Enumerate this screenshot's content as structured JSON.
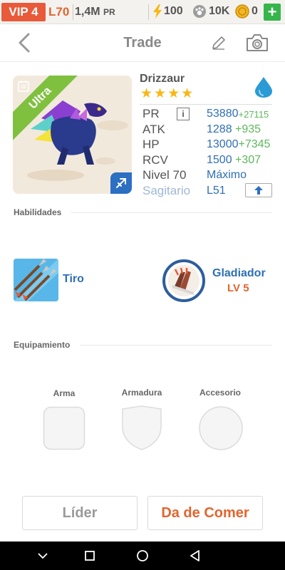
{
  "topbar": {
    "vip": "VIP 4",
    "level": "L70",
    "power": "1,4M",
    "power_unit": "PR",
    "energy": "100",
    "food": "10K",
    "coins": "0",
    "add": "+"
  },
  "header": {
    "title": "Trade"
  },
  "monster": {
    "name": "Drizzaur",
    "rarity": "Ultra",
    "stars": [
      "★",
      "★",
      "★",
      "★"
    ],
    "stats": [
      {
        "label": "PR",
        "value": "53880",
        "bonus": "+27115"
      },
      {
        "label": "ATK",
        "value": "1288",
        "bonus": " +935"
      },
      {
        "label": "HP",
        "value": "13000",
        "bonus": "+7345"
      },
      {
        "label": "RCV",
        "value": "1500",
        "bonus": " +307"
      },
      {
        "label": "Nivel 70",
        "value": "Máximo",
        "bonus": ""
      },
      {
        "label": "Sagitario",
        "value": "L51",
        "bonus": ""
      }
    ],
    "info": "i"
  },
  "abilities": {
    "section_label": "Habilidades",
    "skill_name": "Tiro",
    "trait_name": "Gladiador",
    "trait_level": "LV 5"
  },
  "equipment": {
    "section_label": "Equipamiento",
    "slots": [
      "Arma",
      "Armadura",
      "Accesorio"
    ]
  },
  "buttons": {
    "leader": "Líder",
    "feed": "Da de Comer"
  },
  "colors": {
    "vip": "#e85a3a",
    "accent_orange": "#e2652e",
    "stat_blue": "#2f6fb3",
    "bonus_green": "#5cb85c",
    "ultra_green": "#7fc03f",
    "star_gold": "#f6b817"
  }
}
